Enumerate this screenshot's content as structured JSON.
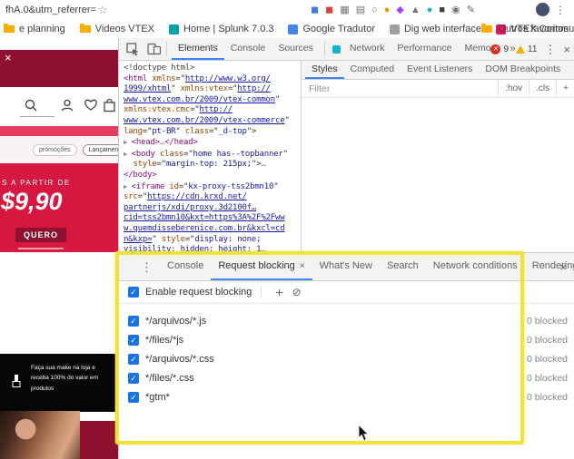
{
  "browser": {
    "url_fragment": "fhA.0&utm_referrer=",
    "star_glyph": "☆",
    "menu_glyph": "⋮",
    "extension_icons": [
      {
        "name": "extension-blue",
        "glyph": "◼",
        "color": "#4a7bd4"
      },
      {
        "name": "extension-red",
        "glyph": "◼",
        "color": "#d9453a"
      },
      {
        "name": "extension-gray-grid",
        "glyph": "▦",
        "color": "#757575"
      },
      {
        "name": "extension-gray-doc",
        "glyph": "▤",
        "color": "#757575"
      },
      {
        "name": "extension-gray-circle",
        "glyph": "○",
        "color": "#757575"
      },
      {
        "name": "extension-orange",
        "glyph": "●",
        "color": "#f29900"
      },
      {
        "name": "extension-purple",
        "glyph": "◆",
        "color": "#a142f4"
      },
      {
        "name": "extension-gray-shield",
        "glyph": "▲",
        "color": "#757575"
      },
      {
        "name": "extension-teal",
        "glyph": "●",
        "color": "#12b5cb"
      },
      {
        "name": "extension-dark",
        "glyph": "■",
        "color": "#3c4043"
      },
      {
        "name": "extension-gray-pin",
        "glyph": "◉",
        "color": "#757575"
      },
      {
        "name": "extension-pencil",
        "glyph": "✎",
        "color": "#5f6368"
      }
    ],
    "bookmarks": [
      {
        "label": "e planning",
        "icon": "folder"
      },
      {
        "label": "Videos VTEX",
        "icon": "folder"
      },
      {
        "label": "Home | Splunk 7.0.3",
        "icon": "favicon",
        "color": "#00a4a6"
      },
      {
        "label": "Google Tradutor",
        "icon": "favicon",
        "color": "#4285f4"
      },
      {
        "label": "Dig web interface",
        "icon": "favicon",
        "color": "#9aa0a6"
      },
      {
        "label": "VTEX Community",
        "icon": "favicon",
        "color": "#ed125f"
      }
    ],
    "other_bookmarks_label": "Outros favoritos"
  },
  "site": {
    "close_glyph": "×",
    "nav_tabs": [
      "promoções",
      "Lançamentos"
    ],
    "promo": {
      "kicker": "S A PARTIR DE",
      "price": "$9,90",
      "cta_label": "QUERO"
    },
    "black_banner_text": "Faça sua make na loja e receba 100% do valor em produtos"
  },
  "devtools": {
    "main_tabs": [
      "Elements",
      "Console",
      "Sources",
      "Network",
      "Performance",
      "Memory"
    ],
    "selected_main_tab": "Elements",
    "more_tabs_glyph": "»",
    "error_count": "9",
    "warning_count": "11",
    "menu_glyph": "⋮",
    "close_glyph": "×",
    "sidebar_tabs": [
      "Styles",
      "Computed",
      "Event Listeners",
      "DOM Breakpoints"
    ],
    "selected_sidebar_tab": "Styles",
    "filter_placeholder": "Filter",
    "pseudo_toggle": ":hov",
    "class_toggle": ".cls",
    "add_glyph": "+",
    "code_lines": [
      [
        {
          "c": "doct",
          "t": "<!doctype html>"
        }
      ],
      [
        {
          "c": "tag",
          "t": "<html "
        },
        {
          "c": "attr",
          "t": "xmlns"
        },
        {
          "c": "pln",
          "t": "=\""
        },
        {
          "c": "link",
          "t": "http://www.w3.org/"
        }
      ],
      [
        {
          "c": "link",
          "t": "1999/xhtml"
        },
        {
          "c": "pln",
          "t": "\" "
        },
        {
          "c": "attr",
          "t": "xmlns:vtex"
        },
        {
          "c": "pln",
          "t": "=\""
        },
        {
          "c": "link",
          "t": "http://"
        }
      ],
      [
        {
          "c": "link",
          "t": "www.vtex.com.br/2009/vtex-common"
        },
        {
          "c": "pln",
          "t": "\""
        }
      ],
      [
        {
          "c": "attr",
          "t": "xmlns:vtex.cmc"
        },
        {
          "c": "pln",
          "t": "=\""
        },
        {
          "c": "link",
          "t": "http://"
        }
      ],
      [
        {
          "c": "link",
          "t": "www.vtex.com.br/2009/vtex-commerce"
        },
        {
          "c": "pln",
          "t": "\""
        }
      ],
      [
        {
          "c": "attr",
          "t": "lang"
        },
        {
          "c": "pln",
          "t": "=\""
        },
        {
          "c": "val",
          "t": "pt-BR"
        },
        {
          "c": "pln",
          "t": "\" "
        },
        {
          "c": "attr",
          "t": "class"
        },
        {
          "c": "pln",
          "t": "=\""
        },
        {
          "c": "val",
          "t": "_d-top"
        },
        {
          "c": "pln",
          "t": "\">"
        }
      ],
      [
        {
          "c": "arr",
          "t": "▶ "
        },
        {
          "c": "tag",
          "t": "<head>"
        },
        {
          "c": "dots",
          "t": "…"
        },
        {
          "c": "tag",
          "t": "</head>"
        }
      ],
      [
        {
          "c": "arr",
          "t": "▶ "
        },
        {
          "c": "tag",
          "t": "<body "
        },
        {
          "c": "attr",
          "t": "class"
        },
        {
          "c": "pln",
          "t": "=\""
        },
        {
          "c": "val",
          "t": "home has--topbanner"
        },
        {
          "c": "pln",
          "t": "\""
        }
      ],
      [
        {
          "c": "pln",
          "t": "  "
        },
        {
          "c": "attr",
          "t": "style"
        },
        {
          "c": "pln",
          "t": "=\""
        },
        {
          "c": "val",
          "t": "margin-top: 215px;"
        },
        {
          "c": "pln",
          "t": "\">"
        },
        {
          "c": "dots",
          "t": "…"
        }
      ],
      [
        {
          "c": "tag",
          "t": "</body>"
        }
      ],
      [
        {
          "c": "arr",
          "t": "▶ "
        },
        {
          "c": "tag",
          "t": "<iframe "
        },
        {
          "c": "attr",
          "t": "id"
        },
        {
          "c": "pln",
          "t": "=\""
        },
        {
          "c": "val",
          "t": "kx-proxy-tss2bmn10"
        },
        {
          "c": "pln",
          "t": "\""
        }
      ],
      [
        {
          "c": "attr",
          "t": "src"
        },
        {
          "c": "pln",
          "t": "=\""
        },
        {
          "c": "link",
          "t": "https://cdn.krxd.net/"
        }
      ],
      [
        {
          "c": "link",
          "t": "partnerjs/xdi/proxy.3d2100f…"
        }
      ],
      [
        {
          "c": "link",
          "t": "cid=tss2bmn10&kxt=https%3A%2F%2Fww"
        }
      ],
      [
        {
          "c": "link",
          "t": "w.quemdisseberenice.com.br&kxcl=cd"
        }
      ],
      [
        {
          "c": "link",
          "t": "n&kxp="
        },
        {
          "c": "pln",
          "t": "\" "
        },
        {
          "c": "attr",
          "t": "style"
        },
        {
          "c": "pln",
          "t": "=\""
        },
        {
          "c": "val",
          "t": "display: none;"
        }
      ],
      [
        {
          "c": "val",
          "t": "visibility: hidden; height: 1"
        },
        {
          "c": "dots",
          "t": "…"
        }
      ]
    ]
  },
  "drawer": {
    "menu_glyph": "⋮",
    "tabs": [
      "Console",
      "Request blocking",
      "What's New",
      "Search",
      "Network conditions",
      "Rendering"
    ],
    "active_tab": "Request blocking",
    "tab_close_glyph": "×",
    "close_glyph": "×",
    "enable_label": "Enable request blocking",
    "add_glyph": "+",
    "clear_glyph": "⊘",
    "rows": [
      {
        "pattern": "*/arquivos/*.js",
        "blocked": "0 blocked"
      },
      {
        "pattern": "*/files/*js",
        "blocked": "0 blocked"
      },
      {
        "pattern": "*/arquivos/*.css",
        "blocked": "0 blocked"
      },
      {
        "pattern": "*/files/*.css",
        "blocked": "0 blocked"
      },
      {
        "pattern": "*gtm*",
        "blocked": "0 blocked"
      }
    ]
  },
  "colors": {
    "accent_blue": "#4285f4",
    "error_red": "#d93025",
    "warning_yellow": "#f9ab00",
    "brand_maroon": "#8e1230",
    "promo_red": "#d6173f",
    "highlight_yellow": "#f0e23e"
  }
}
